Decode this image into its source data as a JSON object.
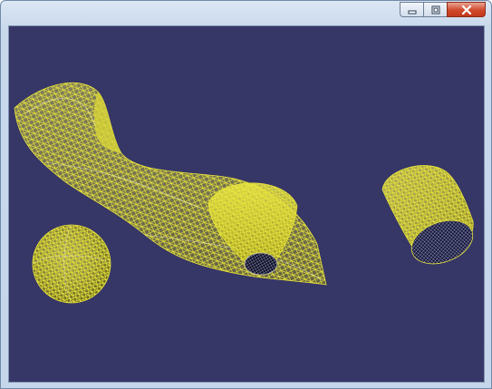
{
  "window": {
    "title": "",
    "controls": {
      "minimize_icon": "minimize-icon",
      "maximize_icon": "restore-icon",
      "close_icon": "close-icon"
    }
  },
  "viewport": {
    "background_color": "#363667",
    "wire_color": "#e8e43a",
    "objects": [
      "swept-surface",
      "cone",
      "sphere",
      "cylinder"
    ]
  }
}
